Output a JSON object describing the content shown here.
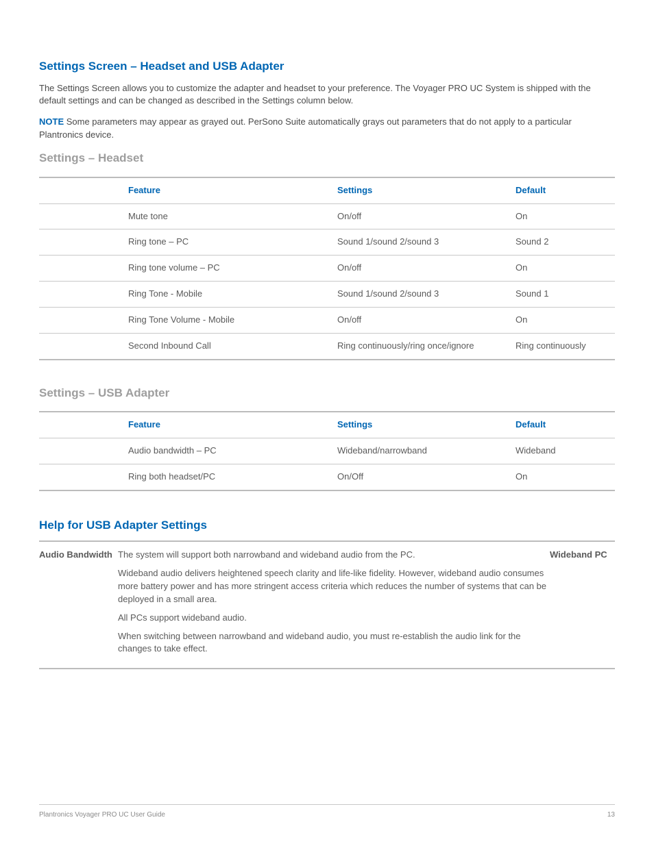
{
  "section1": {
    "title": "Settings Screen – Headset and USB Adapter",
    "para1": "The Settings Screen allows you to customize the adapter and headset to your preference. The Voyager PRO UC System is shipped with the default settings and can be changed as described in the Settings column below.",
    "note_label": "NOTE",
    "note_text": " Some parameters may appear as grayed out. PerSono Suite automatically grays out parameters that do not apply to a particular Plantronics device."
  },
  "headset": {
    "subtitle": "Settings – Headset",
    "headers": {
      "feature": "Feature",
      "settings": "Settings",
      "default": "Default"
    },
    "rows": [
      {
        "feature": "Mute tone",
        "settings": "On/off",
        "default": "On"
      },
      {
        "feature": "Ring tone – PC",
        "settings": "Sound 1/sound 2/sound 3",
        "default": "Sound 2"
      },
      {
        "feature": "Ring tone volume – PC",
        "settings": "On/off",
        "default": "On"
      },
      {
        "feature": "Ring Tone - Mobile",
        "settings": "Sound 1/sound 2/sound 3",
        "default": "Sound 1"
      },
      {
        "feature": "Ring Tone Volume - Mobile",
        "settings": "On/off",
        "default": "On"
      },
      {
        "feature": "Second Inbound Call",
        "settings": "Ring continuously/ring once/ignore",
        "default": "Ring continuously"
      }
    ]
  },
  "usb": {
    "subtitle": "Settings – USB Adapter",
    "headers": {
      "feature": "Feature",
      "settings": "Settings",
      "default": "Default"
    },
    "rows": [
      {
        "feature": "Audio bandwidth – PC",
        "settings": "Wideband/narrowband",
        "default": "Wideband"
      },
      {
        "feature": "Ring both headset/PC",
        "settings": "On/Off",
        "default": "On"
      }
    ]
  },
  "help": {
    "title": "Help for USB Adapter Settings",
    "left_label": "Audio Bandwidth",
    "right_label": "Wideband PC",
    "paras": [
      "The system will support both narrowband and wideband audio from the PC.",
      "Wideband audio delivers heightened speech clarity and life-like fidelity. However, wideband audio consumes more battery power and has more stringent access criteria which reduces the number of systems that can be deployed in a small area.",
      "All PCs support wideband audio.",
      "When switching between narrowband and wideband audio, you must re-establish the audio link for the changes to take effect."
    ]
  },
  "footer": {
    "left": "Plantronics Voyager PRO UC User Guide",
    "right": "13"
  }
}
